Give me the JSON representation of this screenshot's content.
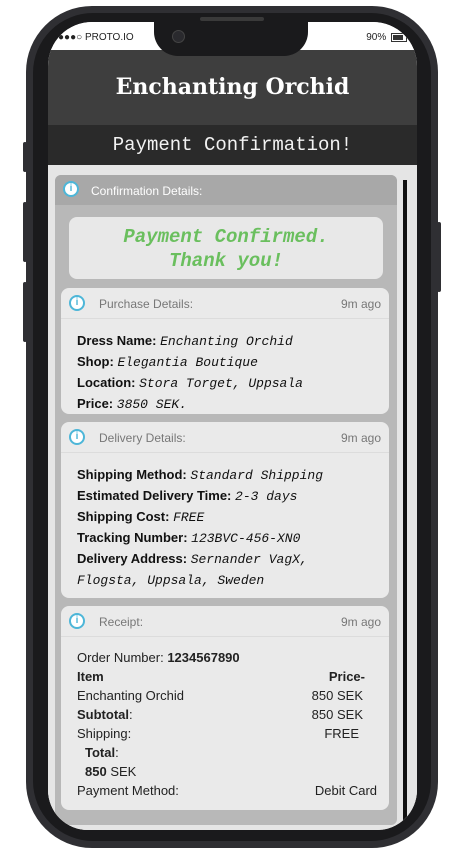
{
  "status_bar": {
    "carrier": "●●●○ PROTO.IO",
    "battery": "90%"
  },
  "app": {
    "title": "Enchanting Orchid",
    "subtitle": "Payment Confirmation!"
  },
  "panel": {
    "title": "Confirmation Details:"
  },
  "banner": {
    "line1": "Payment Confirmed.",
    "line2": "Thank you!"
  },
  "purchase": {
    "label": "Purchase Details:",
    "time": "9m ago",
    "fields": [
      {
        "k": "Dress Name:",
        "v": "Enchanting Orchid"
      },
      {
        "k": "Shop:",
        "v": "Elegantia Boutique"
      },
      {
        "k": "Location:",
        "v": "Stora Torget, Uppsala"
      },
      {
        "k": "Price:",
        "v": "3850 SEK."
      }
    ]
  },
  "delivery": {
    "label": "Delivery Details:",
    "time": "9m ago",
    "fields": [
      {
        "k": "Shipping Method:",
        "v": "Standard Shipping"
      },
      {
        "k": "Estimated Delivery Time:",
        "v": "2-3 days"
      },
      {
        "k": "Shipping Cost:",
        "v": "FREE"
      },
      {
        "k": "Tracking Number:",
        "v": "123BVC-456-XN0"
      },
      {
        "k": "Delivery Address:",
        "v": "Sernander VagX,"
      },
      {
        "k": "",
        "v": "Flogsta, Uppsala, Sweden"
      }
    ]
  },
  "receipt": {
    "label": "Receipt:",
    "time": "9m ago",
    "order_label": "Order Number:",
    "order_number": "1234567890",
    "item_header": "Item",
    "price_header": "Price-",
    "item_name": "Enchanting Orchid",
    "item_price": "850 SEK",
    "subtotal_label": "Subtotal",
    "subtotal_colon": ":",
    "subtotal_value": "850 SEK",
    "shipping_label": "Shipping:",
    "shipping_value": "FREE",
    "total_label": "Total",
    "total_colon": ":",
    "total_amount": "850",
    "total_currency": "SEK",
    "payment_label": "Payment Method:",
    "payment_value": "Debit Card"
  }
}
